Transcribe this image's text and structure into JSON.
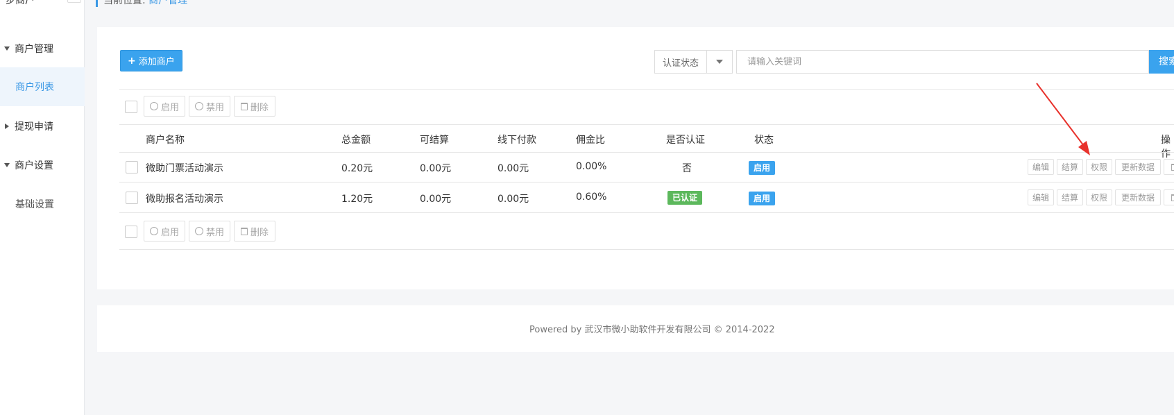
{
  "sidebar": {
    "top_name": "步商户",
    "groups": [
      {
        "label": "商户管理",
        "expanded": true
      },
      {
        "label": "提现申请",
        "expanded": false
      },
      {
        "label": "商户设置",
        "expanded": true
      }
    ],
    "items": [
      {
        "label": "商户列表",
        "active": true
      },
      {
        "label": "基础设置",
        "active": false
      }
    ]
  },
  "breadcrumb": {
    "prefix": "当前位置:",
    "current": "商户管理"
  },
  "toolbar": {
    "add_label": "添加商户",
    "filter_label": "认证状态",
    "search_placeholder": "请输入关键词",
    "search_label": "搜索"
  },
  "bulk_actions": {
    "enable": "启用",
    "disable": "禁用",
    "delete": "删除"
  },
  "table": {
    "headers": [
      "商户名称",
      "总金额",
      "可结算",
      "线下付款",
      "佣金比",
      "是否认证",
      "状态",
      "操作"
    ],
    "rows": [
      {
        "name": "微助门票活动演示",
        "total": "0.20元",
        "settle": "0.00元",
        "offline": "0.00元",
        "commission": "0.00%",
        "verified": "否",
        "verified_badge": false,
        "status": "启用"
      },
      {
        "name": "微助报名活动演示",
        "total": "1.20元",
        "settle": "0.00元",
        "offline": "0.00元",
        "commission": "0.60%",
        "verified": "已认证",
        "verified_badge": true,
        "status": "启用"
      }
    ],
    "row_actions": [
      "编辑",
      "结算",
      "权限",
      "更新数据"
    ]
  },
  "footer": {
    "text": "Powered by 武汉市微小助软件开发有限公司 © 2014-2022"
  },
  "colors": {
    "primary": "#3aa3ee",
    "success": "#5cb85c",
    "annotation": "#e8322c"
  }
}
